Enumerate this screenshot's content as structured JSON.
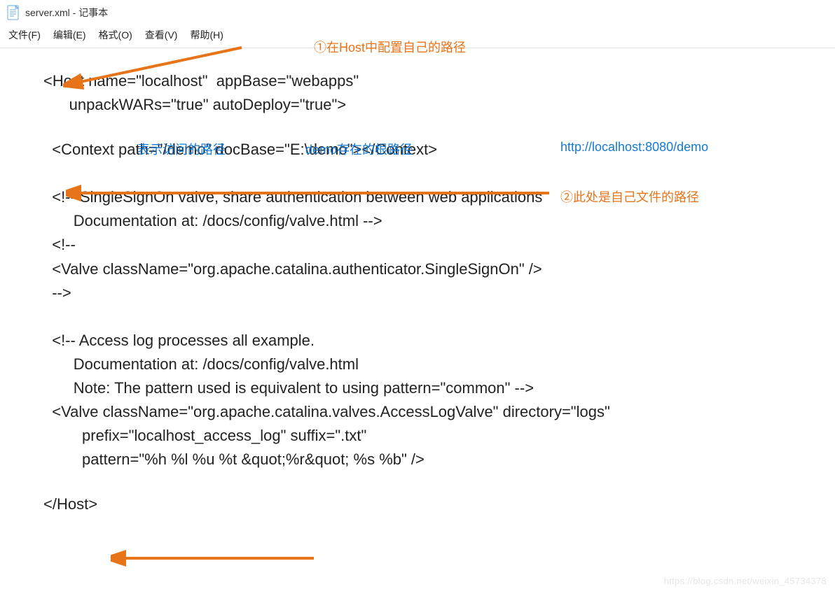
{
  "window": {
    "title": "server.xml - 记事本"
  },
  "menu": {
    "file": "文件(F)",
    "edit": "编辑(E)",
    "format": "格式(O)",
    "view": "查看(V)",
    "help": "帮助(H)"
  },
  "annotations": {
    "note1": "①在Host中配置自己的路径",
    "label_path": "表示访问的路径",
    "label_docbase": "demo存在的根路径",
    "example_url": "http://localhost:8080/demo",
    "note2": "②此处是自己文件的路径"
  },
  "code": {
    "l1": "<Host name=\"localhost\"  appBase=\"webapps\"",
    "l2": "      unpackWARs=\"true\" autoDeploy=\"true\">",
    "l3": "  <Context path=\"/demo\" docBase=\"E:\\demo\"></Context>",
    "l4": "  <!-- SingleSignOn valve, share authentication between web applications",
    "l5": "       Documentation at: /docs/config/valve.html -->",
    "l5b": "  <!--",
    "l6": "  <Valve className=\"org.apache.catalina.authenticator.SingleSignOn\" />",
    "l7": "  -->",
    "l8": "  <!-- Access log processes all example.",
    "l9": "       Documentation at: /docs/config/valve.html",
    "l10": "       Note: The pattern used is equivalent to using pattern=\"common\" -->",
    "l11": "  <Valve className=\"org.apache.catalina.valves.AccessLogValve\" directory=\"logs\"",
    "l12": "         prefix=\"localhost_access_log\" suffix=\".txt\"",
    "l13": "         pattern=\"%h %l %u %t &quot;%r&quot; %s %b\" />",
    "l14": "</Host>"
  },
  "watermark": "https://blog.csdn.net/weixin_45734378"
}
